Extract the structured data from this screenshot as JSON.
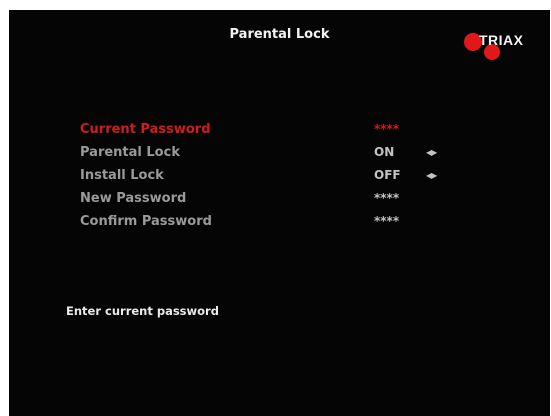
{
  "screen": {
    "title": "Parental Lock",
    "logo_text": "TRIAX",
    "logo_color": "#e01818",
    "highlight_color": "#d01c1c"
  },
  "menu": {
    "items": [
      {
        "label": "Current Password",
        "value": "****",
        "selected": true
      },
      {
        "label": "Parental Lock",
        "value": "ON",
        "has_arrows": true,
        "arrow_icon": "left-right-arrows-icon"
      },
      {
        "label": "Install Lock",
        "value": "OFF",
        "has_arrows": true,
        "arrow_icon": "left-right-arrows-icon"
      },
      {
        "label": "New Password",
        "value": "****"
      },
      {
        "label": "Confirm Password",
        "value": "****"
      }
    ]
  },
  "status": {
    "hint": "Enter current password"
  }
}
